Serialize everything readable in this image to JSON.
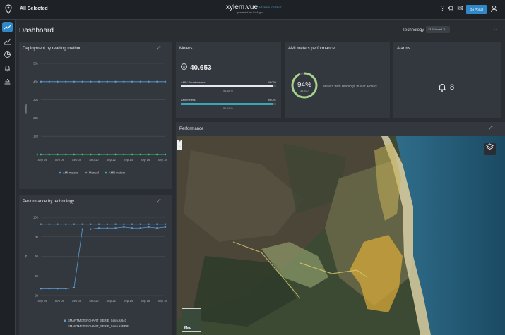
{
  "topbar": {
    "selection": "All Selected",
    "brand": "xylem",
    "brand_suffix": "vue",
    "brand_sub": "powered by GoAigua",
    "brand_tag": "INTERNAL OUTPUT",
    "portal_label": "Go Portal",
    "icons": [
      "location-icon",
      "help-icon",
      "gear-icon",
      "mail-icon",
      "user-icon"
    ]
  },
  "page": {
    "title": "Dashboard",
    "technology_label": "Technology",
    "technology_chip": "13 Selected"
  },
  "deployment": {
    "title": "Deployment by reading method",
    "chart_data": {
      "type": "line",
      "title": "Deployment by reading method",
      "ylabel": "Meters",
      "ylim": [
        0,
        50000
      ],
      "yticks": [
        "0",
        "10k",
        "20k",
        "30k",
        "40k",
        "50k"
      ],
      "x": [
        "Sep 04",
        "Sep 06",
        "Sep 08",
        "Sep 10",
        "Sep 12",
        "Sep 14",
        "Sep 16",
        "Sep 18"
      ],
      "series": [
        {
          "name": "AMI meters",
          "color": "#5b9bd5",
          "values": [
            40000,
            40000,
            40000,
            40000,
            40000,
            40000,
            40000,
            40000,
            40000,
            40000,
            40000,
            40000,
            40000,
            40000,
            40000,
            40000
          ]
        },
        {
          "name": "Manual",
          "color": "#7f8790",
          "values": [
            0,
            0,
            0,
            0,
            0,
            0,
            0,
            0,
            0,
            0,
            0,
            0,
            0,
            0,
            0,
            0
          ]
        },
        {
          "name": "AMR meters",
          "color": "#2ecc71",
          "values": [
            0,
            0,
            0,
            0,
            0,
            0,
            0,
            0,
            0,
            0,
            0,
            0,
            0,
            0,
            0,
            0
          ]
        }
      ]
    }
  },
  "performance_tech": {
    "title": "Performance by technology",
    "chart_data": {
      "type": "line",
      "title": "Performance by technology",
      "ylabel": "%",
      "ylim": [
        20,
        100
      ],
      "yticks": [
        "20",
        "40",
        "60",
        "80",
        "100"
      ],
      "x": [
        "Sep 04",
        "Sep 06",
        "Sep 08",
        "Sep 10",
        "Sep 12",
        "Sep 14",
        "Sep 16",
        "Sep 18"
      ],
      "series": [
        {
          "name": "SMARTMETERCHART_SERIE_Sensus 640",
          "color": "#5b9bd5",
          "values": [
            27,
            27,
            27,
            27,
            28,
            88,
            88,
            89,
            89,
            89,
            90,
            89,
            89,
            90,
            89,
            90
          ]
        },
        {
          "name": "SMARTMETERCHART_SERIE_Sensus iPERL",
          "color": "#5b9bd5",
          "values": [
            93,
            93,
            93,
            93,
            93,
            93,
            93,
            93,
            93,
            93,
            93,
            93,
            93,
            93,
            93,
            93
          ]
        }
      ]
    }
  },
  "meters": {
    "title": "Meters",
    "total": "40.653",
    "rows": [
      {
        "label": "AMI / Smart meters",
        "count": "39.099",
        "pct": "96.18 %",
        "fraction": 0.9618,
        "color": "#e6e8ea"
      },
      {
        "label": "AMI meters",
        "count": "39.091",
        "pct": "96.16 %",
        "fraction": 0.9616,
        "color": "#3aa6b9"
      }
    ]
  },
  "ami_perf": {
    "title": "AMI meters performance",
    "value": "94%",
    "value_num": 0.94,
    "value_sub": "38.877",
    "description": "Meters with readings in last 4 days"
  },
  "alarms": {
    "title": "Alarms",
    "count": "8"
  },
  "performance_map": {
    "title": "Performance",
    "zoom_in": "+",
    "zoom_out": "−",
    "basemap_label": "Map"
  }
}
